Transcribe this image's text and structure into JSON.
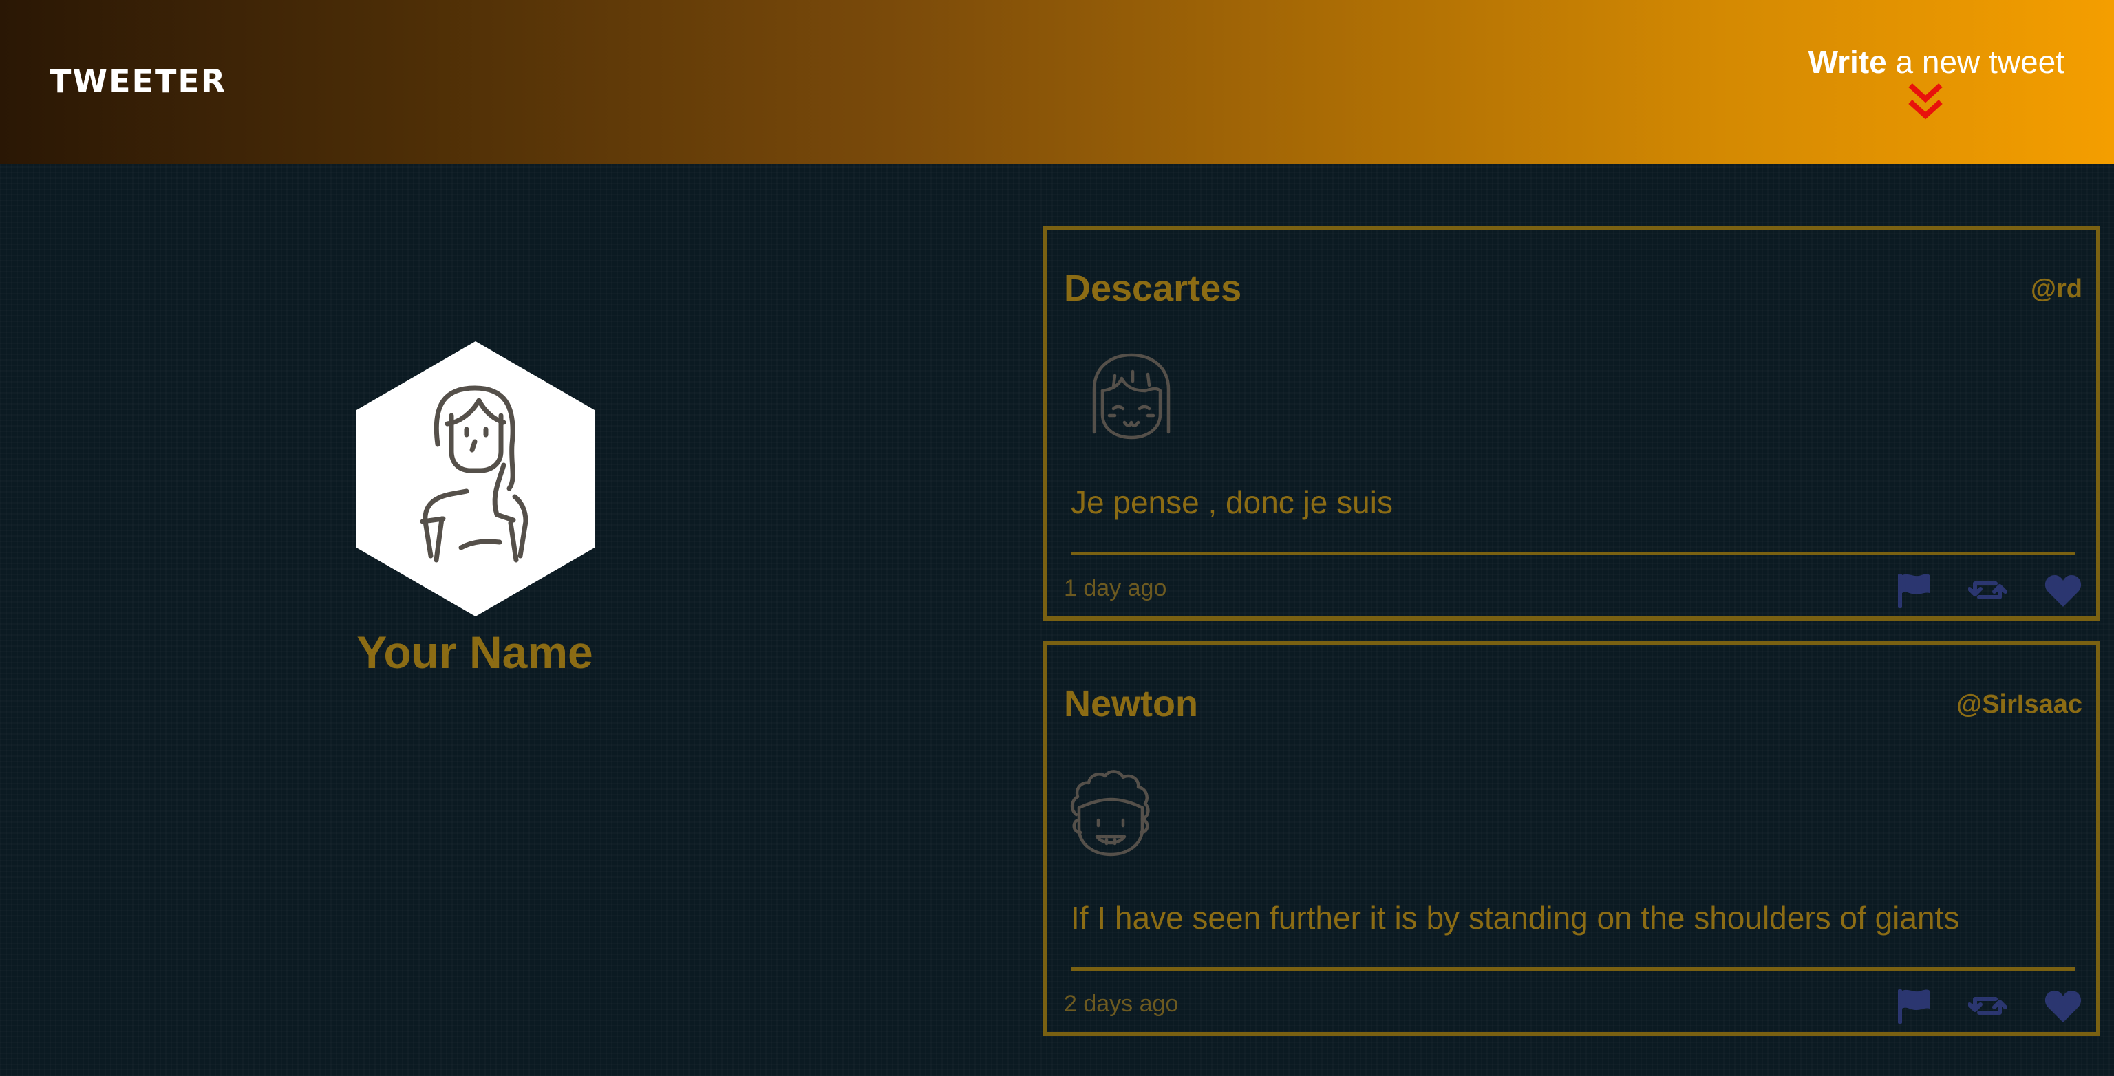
{
  "nav": {
    "brand": "TWEETER",
    "compose_strong": "Write",
    "compose_light": " a new tweet",
    "compose_icon": "double-chevron-down-icon",
    "arrow_color": "#e8120c"
  },
  "profile": {
    "name": "Your Name",
    "avatar_icon": "woman-avatar-icon"
  },
  "tweets": [
    {
      "author": "Descartes",
      "handle": "@rd",
      "avatar_icon": "girl-face-avatar-icon",
      "text": "Je pense , donc je suis",
      "time": "1 day ago"
    },
    {
      "author": "Newton",
      "handle": "@SirIsaac",
      "avatar_icon": "curly-hair-face-avatar-icon",
      "text": "If I have seen further it is by standing on the shoulders of giants",
      "time": "2 days ago"
    }
  ],
  "actions": {
    "flag_icon": "flag-icon",
    "retweet_icon": "retweet-icon",
    "like_icon": "heart-icon",
    "icon_color": "#2b3670"
  },
  "colors": {
    "accent": "#8c6c14",
    "border": "#7a6112",
    "background": "#0b1a22"
  }
}
